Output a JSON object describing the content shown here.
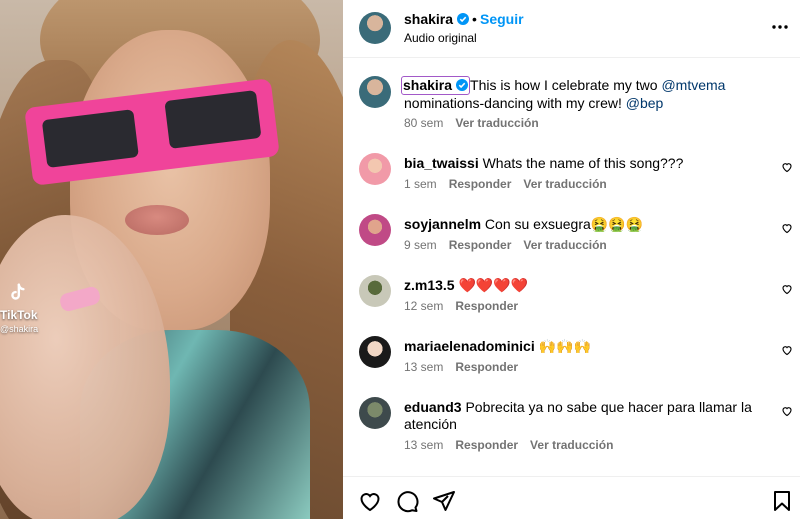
{
  "media": {
    "watermark": {
      "brand": "TikTok",
      "handle": "@shakira"
    }
  },
  "header": {
    "username": "shakira",
    "separator": "•",
    "follow_label": "Seguir",
    "audio_label": "Audio original",
    "more_icon": "more-horizontal-icon"
  },
  "caption": {
    "username": "shakira",
    "text_before": "This is how I celebrate my two ",
    "mention1": "@mtvema",
    "text_middle": " nominations-dancing with my crew! ",
    "mention2": "@bep",
    "time": "80 sem",
    "translate": "Ver traducción"
  },
  "comments": [
    {
      "username": "bia_twaissi",
      "text": "Whats the name of this song???",
      "time": "1 sem",
      "reply": "Responder",
      "translate": "Ver traducción"
    },
    {
      "username": "soyjannelm",
      "text": "Con su exsuegra🤮🤮🤮",
      "time": "9 sem",
      "reply": "Responder",
      "translate": "Ver traducción"
    },
    {
      "username": "z.m13.5",
      "text": "❤️❤️❤️❤️",
      "time": "12 sem",
      "reply": "Responder",
      "translate": ""
    },
    {
      "username": "mariaelenadominici",
      "text": "🙌🙌🙌",
      "time": "13 sem",
      "reply": "Responder",
      "translate": ""
    },
    {
      "username": "eduand3",
      "text": "Pobrecita ya no sabe que hacer para llamar la atención",
      "time": "13 sem",
      "reply": "Responder",
      "translate": "Ver traducción"
    }
  ],
  "footer": {
    "icons": [
      "heart-icon",
      "comment-icon",
      "share-icon",
      "bookmark-icon"
    ]
  },
  "colors": {
    "accent": "#0095f6",
    "verified": "#0095f6",
    "secondary_text": "#737373",
    "mention": "#00376b",
    "glasses": "#f0449a"
  }
}
